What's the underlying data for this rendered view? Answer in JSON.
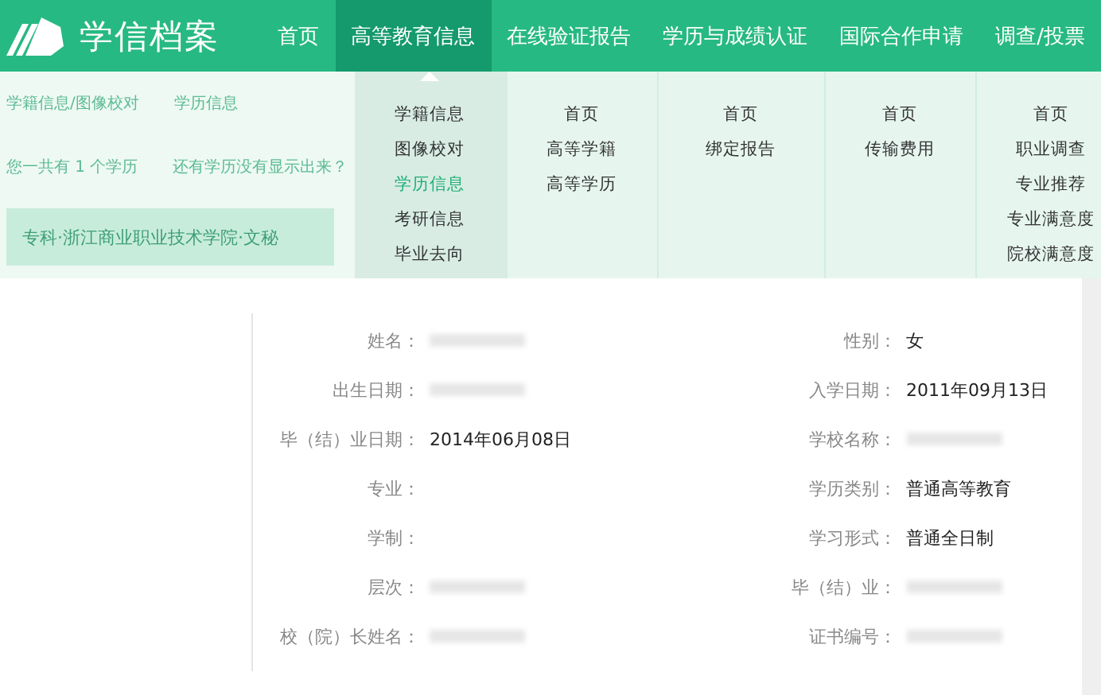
{
  "header": {
    "logo_text": "学信档案",
    "nav": [
      {
        "label": "首页",
        "selected": false
      },
      {
        "label": "高等教育信息",
        "selected": true,
        "menu": [
          {
            "label": "学籍信息",
            "selected": false
          },
          {
            "label": "图像校对",
            "selected": false
          },
          {
            "label": "学历信息",
            "selected": true
          },
          {
            "label": "考研信息",
            "selected": false
          },
          {
            "label": "毕业去向",
            "selected": false
          }
        ]
      },
      {
        "label": "在线验证报告",
        "selected": false,
        "menu": [
          {
            "label": "首页",
            "selected": false
          },
          {
            "label": "高等学籍",
            "selected": false
          },
          {
            "label": "高等学历",
            "selected": false
          }
        ]
      },
      {
        "label": "学历与成绩认证",
        "selected": false,
        "menu": [
          {
            "label": "首页",
            "selected": false
          },
          {
            "label": "绑定报告",
            "selected": false
          }
        ]
      },
      {
        "label": "国际合作申请",
        "selected": false,
        "menu": [
          {
            "label": "首页",
            "selected": false
          },
          {
            "label": "传输费用",
            "selected": false
          }
        ]
      },
      {
        "label": "调查/投票",
        "selected": false,
        "menu": [
          {
            "label": "首页",
            "selected": false
          },
          {
            "label": "职业调查",
            "selected": false
          },
          {
            "label": "专业推荐",
            "selected": false
          },
          {
            "label": "专业满意度",
            "selected": false
          },
          {
            "label": "院校满意度",
            "selected": false
          }
        ]
      }
    ]
  },
  "behind": {
    "subtabs": [
      "学籍信息/图像校对",
      "学历信息"
    ],
    "count_text": "您一共有 1 个学历",
    "missing_text": "还有学历没有显示出来？",
    "record_button": "专科·浙江商业职业技术学院·文秘"
  },
  "details": [
    {
      "label": "姓名：",
      "redacted": true
    },
    {
      "label": "性别：",
      "value": "女"
    },
    {
      "label": "出生日期：",
      "redacted": true
    },
    {
      "label": "入学日期：",
      "value": "2011年09月13日"
    },
    {
      "label": "毕（结）业日期：",
      "value": "2014年06月08日"
    },
    {
      "label": "学校名称：",
      "redacted": true
    },
    {
      "label": "专业："
    },
    {
      "label": "学历类别：",
      "value": "普通高等教育"
    },
    {
      "label": "学制："
    },
    {
      "label": "学习形式：",
      "value": "普通全日制"
    },
    {
      "label": "层次：",
      "redacted": true
    },
    {
      "label": "毕（结）业：",
      "redacted": true
    },
    {
      "label": "校（院）长姓名：",
      "redacted": true
    },
    {
      "label": "证书编号：",
      "redacted": true
    }
  ]
}
